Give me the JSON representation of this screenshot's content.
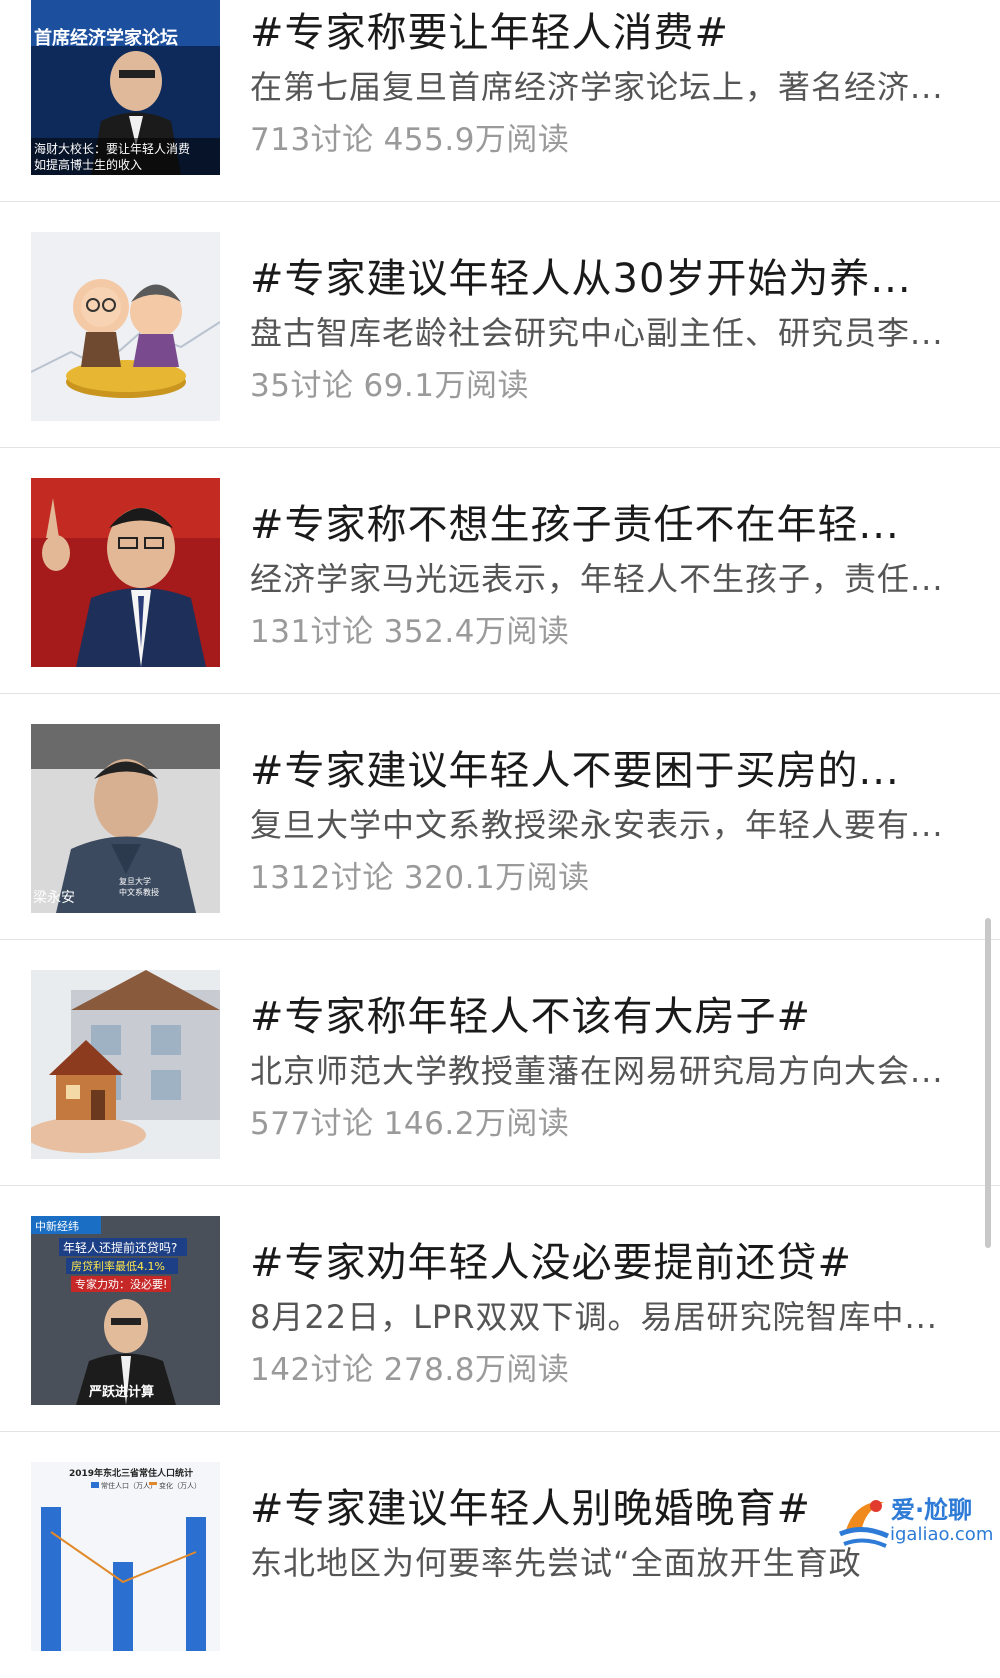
{
  "feed": {
    "items": [
      {
        "title": "#专家称要让年轻人消费#",
        "desc": "在第七届复旦首席经济学家论坛上，著名经济...",
        "discussions": "713讨论",
        "reads": "455.9万阅读",
        "thumb_text": [
          "首席经济学家论坛",
          "海财大校长：要让年轻人消费",
          "如提高博士生的收入"
        ]
      },
      {
        "title": "#专家建议年轻人从30岁开始为养...",
        "desc": "盘古智库老龄社会研究中心副主任、研究员李...",
        "discussions": "35讨论",
        "reads": "69.1万阅读"
      },
      {
        "title": "#专家称不想生孩子责任不在年轻...",
        "desc": "经济学家马光远表示，年轻人不生孩子，责任...",
        "discussions": "131讨论",
        "reads": "352.4万阅读"
      },
      {
        "title": "#专家建议年轻人不要困于买房的...",
        "desc": "复旦大学中文系教授梁永安表示，年轻人要有...",
        "discussions": "1312讨论",
        "reads": "320.1万阅读",
        "thumb_text": [
          "梁永安",
          "复旦大学",
          "中文系教授"
        ]
      },
      {
        "title": "#专家称年轻人不该有大房子#",
        "desc": "北京师范大学教授董藩在网易研究局方向大会...",
        "discussions": "577讨论",
        "reads": "146.2万阅读"
      },
      {
        "title": "#专家劝年轻人没必要提前还贷#",
        "desc": "8月22日，LPR双双下调。易居研究院智库中...",
        "discussions": "142讨论",
        "reads": "278.8万阅读",
        "thumb_text": [
          "中新经纬",
          "年轻人还提前还贷吗?",
          "房贷利率最低4.1%",
          "专家力劝：没必要!",
          "严跃进计算"
        ]
      },
      {
        "title": "#专家建议年轻人别晚婚晚育#",
        "desc": "东北地区为何要率先尝试“全面放开生育政",
        "thumb_text": [
          "2019年东北三省常住人口统计",
          "常住人口（万人）",
          "变化（万人）"
        ]
      }
    ]
  },
  "watermark": {
    "text": "爱·尬聊",
    "domain": "igaliao.com"
  },
  "colors": {
    "title": "#1a1a1a",
    "desc": "#555555",
    "stats": "#9a9a9a",
    "divider": "#e3e3e3",
    "watermark": "#2d7bd6"
  }
}
